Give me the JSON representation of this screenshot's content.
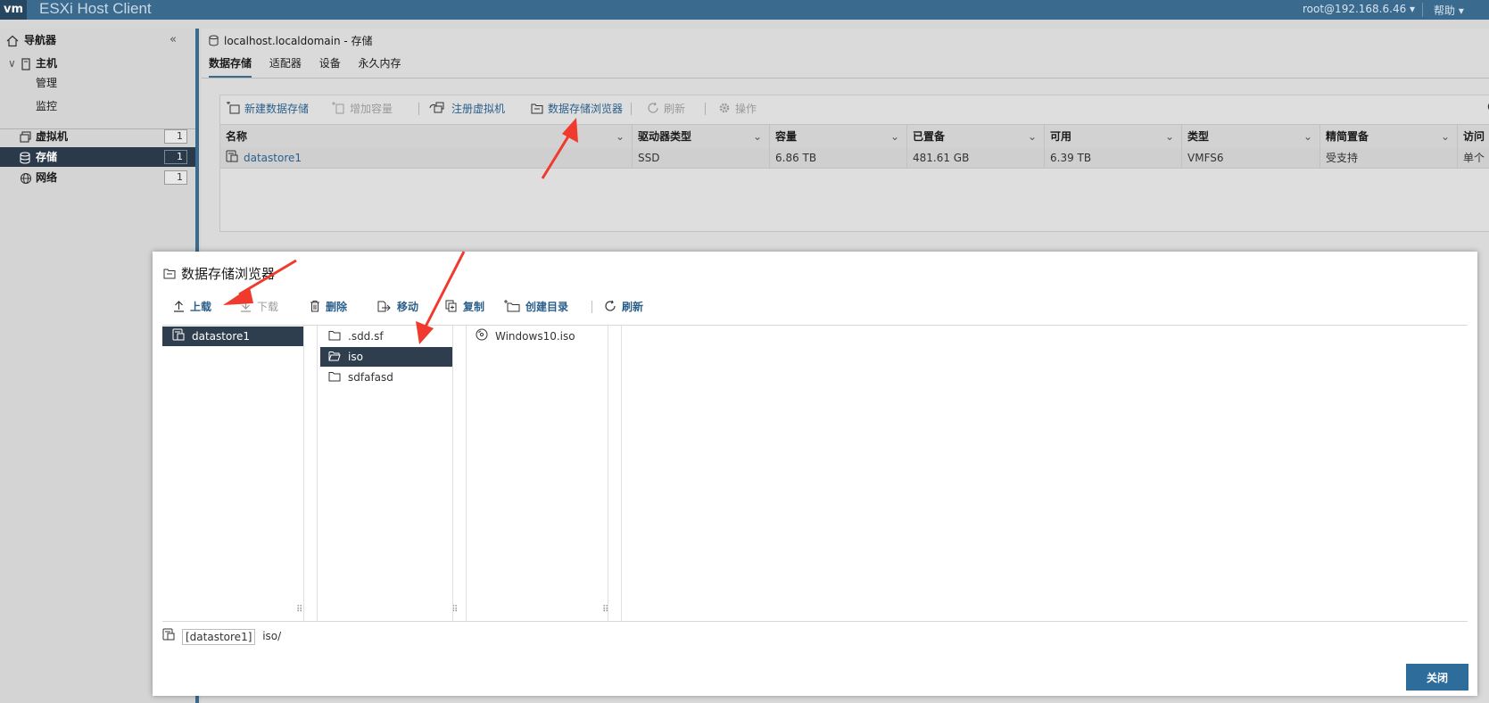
{
  "topbar": {
    "logo": "vm",
    "title": "ESXi Host Client",
    "user": "root@192.168.6.46 ▾",
    "help": "帮助 ▾"
  },
  "sidebar": {
    "navigator": "导航器",
    "host": "主机",
    "manage": "管理",
    "monitor": "监控",
    "items": [
      {
        "label": "虚拟机",
        "count": "1"
      },
      {
        "label": "存储",
        "count": "1"
      },
      {
        "label": "网络",
        "count": "1"
      }
    ]
  },
  "main": {
    "heading": "localhost.localdomain - 存储",
    "tabs": [
      "数据存储",
      "适配器",
      "设备",
      "永久内存"
    ],
    "toolbar": {
      "new_datastore": "新建数据存储",
      "increase_capacity": "增加容量",
      "register_vm": "注册虚拟机",
      "datastore_browser": "数据存储浏览器",
      "refresh": "刷新",
      "actions": "操作"
    },
    "columns": [
      "名称",
      "驱动器类型",
      "容量",
      "已置备",
      "可用",
      "类型",
      "精简置备",
      "访问"
    ],
    "row": [
      "datastore1",
      "SSD",
      "6.86 TB",
      "481.61 GB",
      "6.39 TB",
      "VMFS6",
      "受支持",
      "单个"
    ]
  },
  "dialog": {
    "title": "数据存储浏览器",
    "toolbar": {
      "upload": "上载",
      "download": "下载",
      "delete": "删除",
      "move": "移动",
      "copy": "复制",
      "create_dir": "创建目录",
      "refresh": "刷新"
    },
    "datastores": [
      "datastore1"
    ],
    "folders": [
      ".sdd.sf",
      "iso",
      "sdfafasd"
    ],
    "files": [
      "Windows10.iso"
    ],
    "path_tag": "[datastore1]",
    "path": "iso/",
    "close": "关闭"
  },
  "colors": {
    "accent": "#2e6c9b",
    "topbar": "#3b6a8f",
    "selection": "#2f3e4e",
    "arrow": "#f03a2e"
  }
}
